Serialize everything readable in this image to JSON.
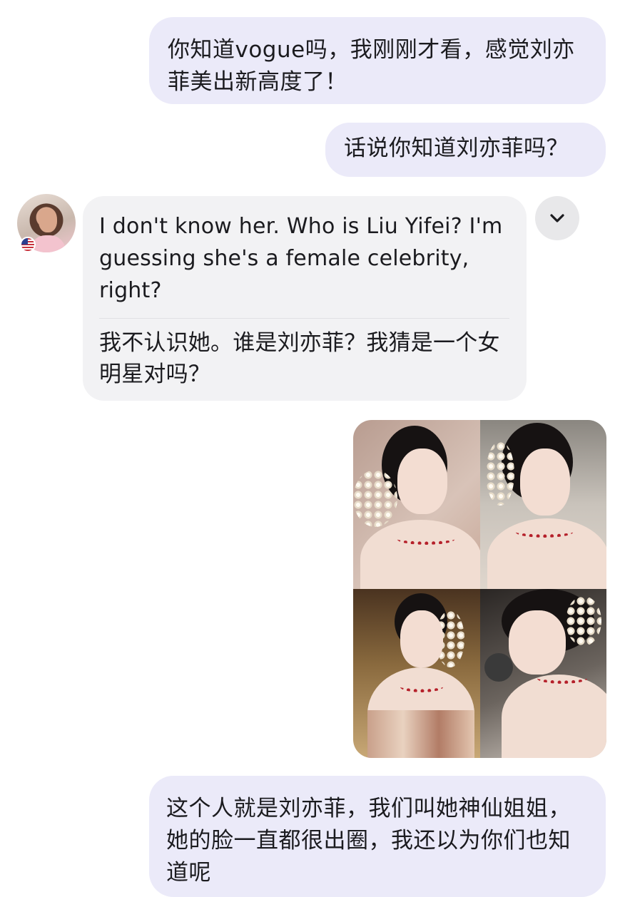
{
  "conversation": {
    "messages": [
      {
        "sender": "me",
        "text": "你知道vogue吗，我刚刚才看，感觉刘亦菲美出新高度了！"
      },
      {
        "sender": "me",
        "text": "话说你知道刘亦菲吗？"
      },
      {
        "sender": "contact",
        "original_text": "I don't know her. Who is Liu Yifei? I'm guessing she's a female celebrity, right?",
        "translated_text": "我不认识她。谁是刘亦菲？我猜是一个女明星对吗？"
      },
      {
        "sender": "me",
        "type": "image",
        "icon": "photo-collage"
      },
      {
        "sender": "me",
        "text": "这个人就是刘亦菲，我们叫她神仙姐姐，她的脸一直都很出圈，我还以为你们也知道呢"
      }
    ]
  },
  "contact": {
    "avatar_icon": "user-avatar",
    "flag_icon": "us-flag-icon"
  },
  "controls": {
    "expand_icon": "chevron-down-icon"
  },
  "colors": {
    "outgoing_bubble": "#ebeaf9",
    "incoming_bubble": "#f2f2f4",
    "background": "#ffffff"
  }
}
